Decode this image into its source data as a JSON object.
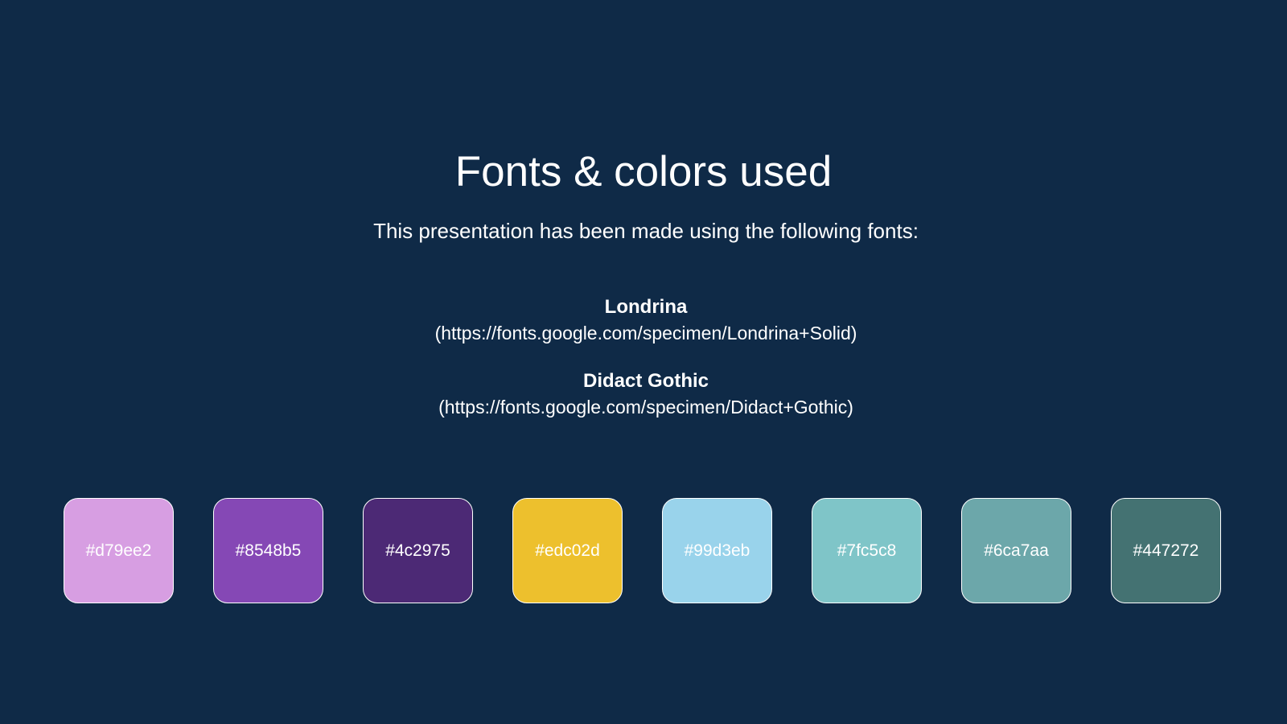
{
  "slide": {
    "title": "Fonts & colors used",
    "subtitle": "This presentation has been made using the following fonts:",
    "fonts": [
      {
        "name": "Londrina",
        "url": "(https://fonts.google.com/specimen/Londrina+Solid)"
      },
      {
        "name": "Didact Gothic",
        "url": "(https://fonts.google.com/specimen/Didact+Gothic)"
      }
    ],
    "colors": [
      {
        "label": "#d79ee2",
        "hex": "#d79ee2"
      },
      {
        "label": "#8548b5",
        "hex": "#8548b5"
      },
      {
        "label": "#4c2975",
        "hex": "#4c2975"
      },
      {
        "label": "#edc02d",
        "hex": "#edc02d"
      },
      {
        "label": "#99d3eb",
        "hex": "#99d3eb"
      },
      {
        "label": "#7fc5c8",
        "hex": "#7fc5c8"
      },
      {
        "label": "#6ca7aa",
        "hex": "#6ca7aa"
      },
      {
        "label": "#447272",
        "hex": "#447272"
      }
    ],
    "background": "#0f2a47"
  }
}
